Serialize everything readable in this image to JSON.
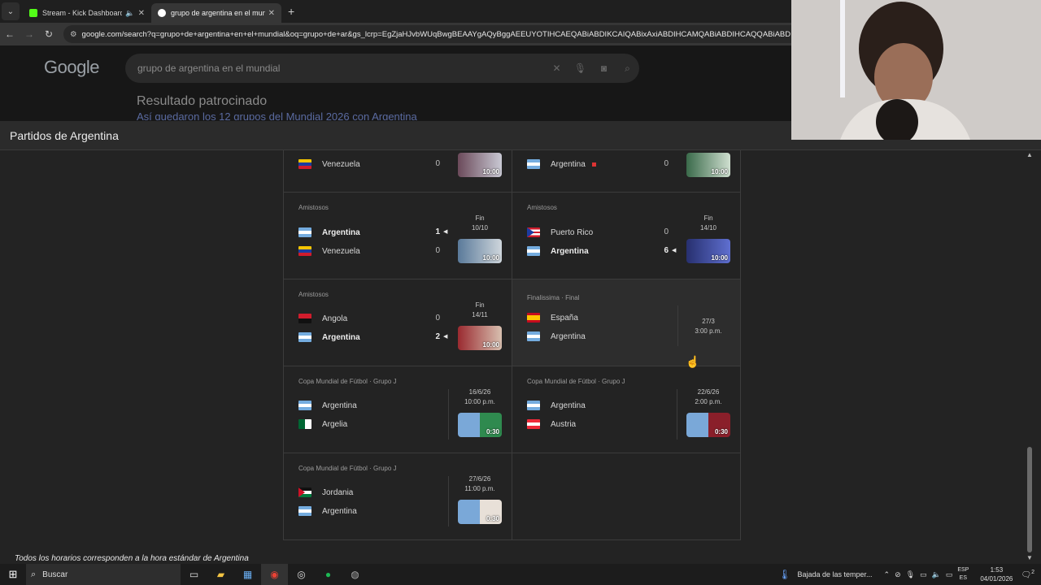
{
  "browser": {
    "tabs": [
      {
        "title": "Stream - Kick Dashboard",
        "favicon_color": "#53fc18",
        "active": false
      },
      {
        "title": "grupo de argentina en el mund",
        "favicon_color": "#4285f4",
        "active": true
      }
    ],
    "url": "google.com/search?q=grupo+de+argentina+en+el+mundial&oq=grupo+de+ar&gs_lcrp=EgZjaHJvbWUqBwgBEAAYgAQyBggAEEUYOTIHCAEQABiABDIKCAIQABixAxiABDIHCAMQABiABDIHCAQQABiABDIHCA"
  },
  "google": {
    "logo": "Google",
    "query": "grupo de argentina en el mundial",
    "sponsored": "Resultado patrocinado",
    "sponsored_link": "Así quedaron los 12 grupos del Mundial 2026 con Argentina"
  },
  "panel": {
    "title": "Partidos de Argentina",
    "footnote": "Todos los horarios corresponden a la hora estándar de Argentina"
  },
  "matches": [
    {
      "competition": "",
      "home": {
        "name": "Venezuela",
        "flag": "venezuela",
        "score": "0"
      },
      "away": null,
      "status": "",
      "thumb_duration": "10:00",
      "thumb_colors": [
        "#6b4a5a",
        "#c9c9d4"
      ]
    },
    {
      "competition": "",
      "home": {
        "name": "Argentina",
        "flag": "argentina",
        "score": "0"
      },
      "away": null,
      "status": "",
      "thumb_duration": "10:00",
      "thumb_colors": [
        "#3a6a4a",
        "#cfdfd0"
      ]
    },
    {
      "competition": "Amistosos",
      "home": {
        "name": "Argentina",
        "flag": "argentina",
        "score": "1",
        "winner": true
      },
      "away": {
        "name": "Venezuela",
        "flag": "venezuela",
        "score": "0"
      },
      "status": "Fin",
      "date": "10/10",
      "thumb_duration": "10:00",
      "thumb_colors": [
        "#5a7a9a",
        "#cfd6dc"
      ]
    },
    {
      "competition": "Amistosos",
      "home": {
        "name": "Puerto Rico",
        "flag": "puertorico",
        "score": "0"
      },
      "away": {
        "name": "Argentina",
        "flag": "argentina",
        "score": "6",
        "winner": true
      },
      "status": "Fin",
      "date": "14/10",
      "thumb_duration": "10:00",
      "thumb_colors": [
        "#27306f",
        "#5f6fd0"
      ]
    },
    {
      "competition": "Amistosos",
      "home": {
        "name": "Angola",
        "flag": "angola",
        "score": "0"
      },
      "away": {
        "name": "Argentina",
        "flag": "argentina",
        "score": "2",
        "winner": true
      },
      "status": "Fin",
      "date": "14/11",
      "thumb_duration": "10:00",
      "thumb_colors": [
        "#9a2a30",
        "#d8c0b0"
      ]
    },
    {
      "competition": "Finalissima · Final",
      "home": {
        "name": "España",
        "flag": "spain"
      },
      "away": {
        "name": "Argentina",
        "flag": "argentina"
      },
      "status": "27/3",
      "date": "3:00 p.m."
    },
    {
      "competition": "Copa Mundial de Fútbol · Grupo J",
      "home": {
        "name": "Argentina",
        "flag": "argentina"
      },
      "away": {
        "name": "Argelia",
        "flag": "algeria"
      },
      "status": "16/6/26",
      "date": "10:00 p.m.",
      "thumb_duration": "0:30",
      "thumb_colors": [
        "#7aa8d8",
        "#2f8a4f"
      ]
    },
    {
      "competition": "Copa Mundial de Fútbol · Grupo J",
      "home": {
        "name": "Argentina",
        "flag": "argentina"
      },
      "away": {
        "name": "Austria",
        "flag": "austria"
      },
      "status": "22/6/26",
      "date": "2:00 p.m.",
      "thumb_duration": "0:30",
      "thumb_colors": [
        "#7aa8d8",
        "#8a1f2a"
      ]
    },
    {
      "competition": "Copa Mundial de Fútbol · Grupo J",
      "home": {
        "name": "Jordania",
        "flag": "jordan"
      },
      "away": {
        "name": "Argentina",
        "flag": "argentina"
      },
      "status": "27/6/26",
      "date": "11:00 p.m.",
      "thumb_duration": "0:30",
      "thumb_colors": [
        "#7aa8d8",
        "#e8e0d8"
      ]
    }
  ],
  "taskbar": {
    "search": "Buscar",
    "weather": "Bajada de las temper...",
    "lang_top": "ESP",
    "lang_bottom": "ES",
    "time": "1:53",
    "date": "04/01/2026",
    "notifications": "2"
  }
}
